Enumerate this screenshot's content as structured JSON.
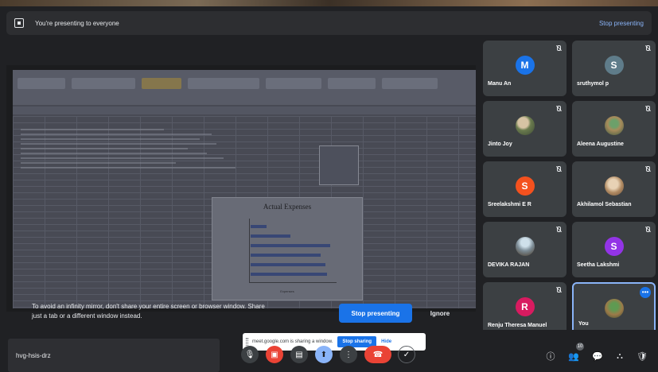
{
  "presenting_bar": {
    "message": "You're presenting to everyone",
    "stop_link": "Stop presenting"
  },
  "shared_screen": {
    "chart_title": "Actual Expenses",
    "chart_xlabel": "Expenses"
  },
  "mirror_warning": {
    "line1": "To avoid an infinity mirror, don't share your entire screen or browser window. Share",
    "line2": "just a tab or a different window instead.",
    "stop_button": "Stop presenting",
    "ignore_button": "Ignore"
  },
  "participants": [
    {
      "name": "Manu An",
      "initial": "M",
      "avatar_color": "#1a73e8",
      "photo": false
    },
    {
      "name": "sruthymol p",
      "initial": "S",
      "avatar_color": "#5f7c8a",
      "photo": false
    },
    {
      "name": "Jinto Joy",
      "initial": "",
      "avatar_color": "",
      "photo": true
    },
    {
      "name": "Aleena Augustine",
      "initial": "",
      "avatar_color": "",
      "photo": true
    },
    {
      "name": "Sreelakshmi E R",
      "initial": "S",
      "avatar_color": "#f4511e",
      "photo": false
    },
    {
      "name": "Akhilamol Sebastian",
      "initial": "",
      "avatar_color": "",
      "photo": true
    },
    {
      "name": "DEVIKA RAJAN",
      "initial": "",
      "avatar_color": "",
      "photo": true
    },
    {
      "name": "Seetha Lakshmi",
      "initial": "S",
      "avatar_color": "#9334e6",
      "photo": false
    },
    {
      "name": "Renju Theresa Manuel",
      "initial": "R",
      "avatar_color": "#d81b60",
      "photo": false
    },
    {
      "name": "You",
      "initial": "",
      "avatar_color": "",
      "photo": true
    }
  ],
  "bottom_bar": {
    "meeting_code": "hvg-hsis-drz",
    "sharing_notice": "meet.google.com is sharing a window.",
    "stop_sharing": "Stop sharing",
    "hide": "Hide",
    "participant_count": "10"
  },
  "icons": {
    "mic": "mic-icon",
    "camera": "camera-icon",
    "captions": "captions-icon",
    "present": "present-icon",
    "more": "more-vert-icon",
    "hangup": "hangup-icon",
    "info": "info-icon",
    "people": "people-icon",
    "chat": "chat-icon",
    "activities": "activities-icon",
    "safety": "host-controls-icon"
  }
}
